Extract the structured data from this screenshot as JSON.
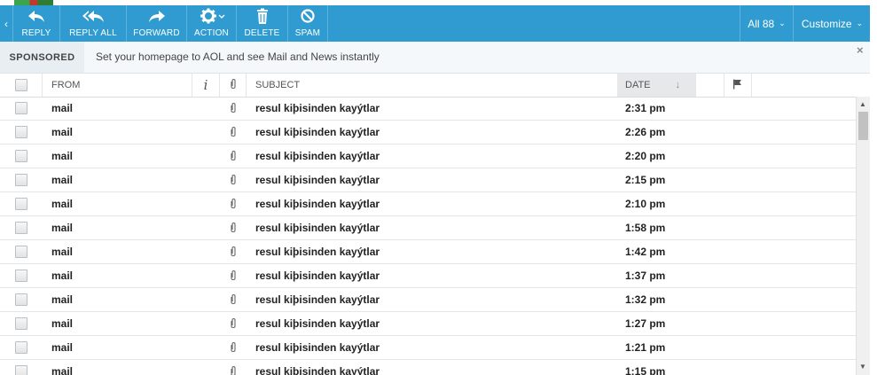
{
  "toolbar": {
    "collapse_arrow": "‹",
    "buttons": [
      {
        "label": "REPLY"
      },
      {
        "label": "REPLY ALL"
      },
      {
        "label": "FORWARD"
      },
      {
        "label": "ACTION"
      },
      {
        "label": "DELETE"
      },
      {
        "label": "SPAM"
      }
    ],
    "all_filter": "All 88",
    "customize": "Customize"
  },
  "sponsored": {
    "tag": "SPONSORED",
    "message": "Set your homepage to AOL and see Mail and News instantly",
    "close": "×"
  },
  "columns": {
    "from": "FROM",
    "info": "i",
    "subject": "SUBJECT",
    "date": "DATE",
    "sort": "↓"
  },
  "messages": [
    {
      "from": "mail",
      "subject": "resul kiþisinden kayýtlar",
      "date": "2:31 pm"
    },
    {
      "from": "mail",
      "subject": "resul kiþisinden kayýtlar",
      "date": "2:26 pm"
    },
    {
      "from": "mail",
      "subject": "resul kiþisinden kayýtlar",
      "date": "2:20 pm"
    },
    {
      "from": "mail",
      "subject": "resul kiþisinden kayýtlar",
      "date": "2:15 pm"
    },
    {
      "from": "mail",
      "subject": "resul kiþisinden kayýtlar",
      "date": "2:10 pm"
    },
    {
      "from": "mail",
      "subject": "resul kiþisinden kayýtlar",
      "date": "1:58 pm"
    },
    {
      "from": "mail",
      "subject": "resul kiþisinden kayýtlar",
      "date": "1:42 pm"
    },
    {
      "from": "mail",
      "subject": "resul kiþisinden kayýtlar",
      "date": "1:37 pm"
    },
    {
      "from": "mail",
      "subject": "resul kiþisinden kayýtlar",
      "date": "1:32 pm"
    },
    {
      "from": "mail",
      "subject": "resul kiþisinden kayýtlar",
      "date": "1:27 pm"
    },
    {
      "from": "mail",
      "subject": "resul kiþisinden kayýtlar",
      "date": "1:21 pm"
    },
    {
      "from": "mail",
      "subject": "resul kiþisinden kayýtlar",
      "date": "1:15 pm"
    }
  ],
  "colors": {
    "toolbar_bg": "#2f9bd1",
    "sponsored_bg": "#f4f8fb"
  }
}
